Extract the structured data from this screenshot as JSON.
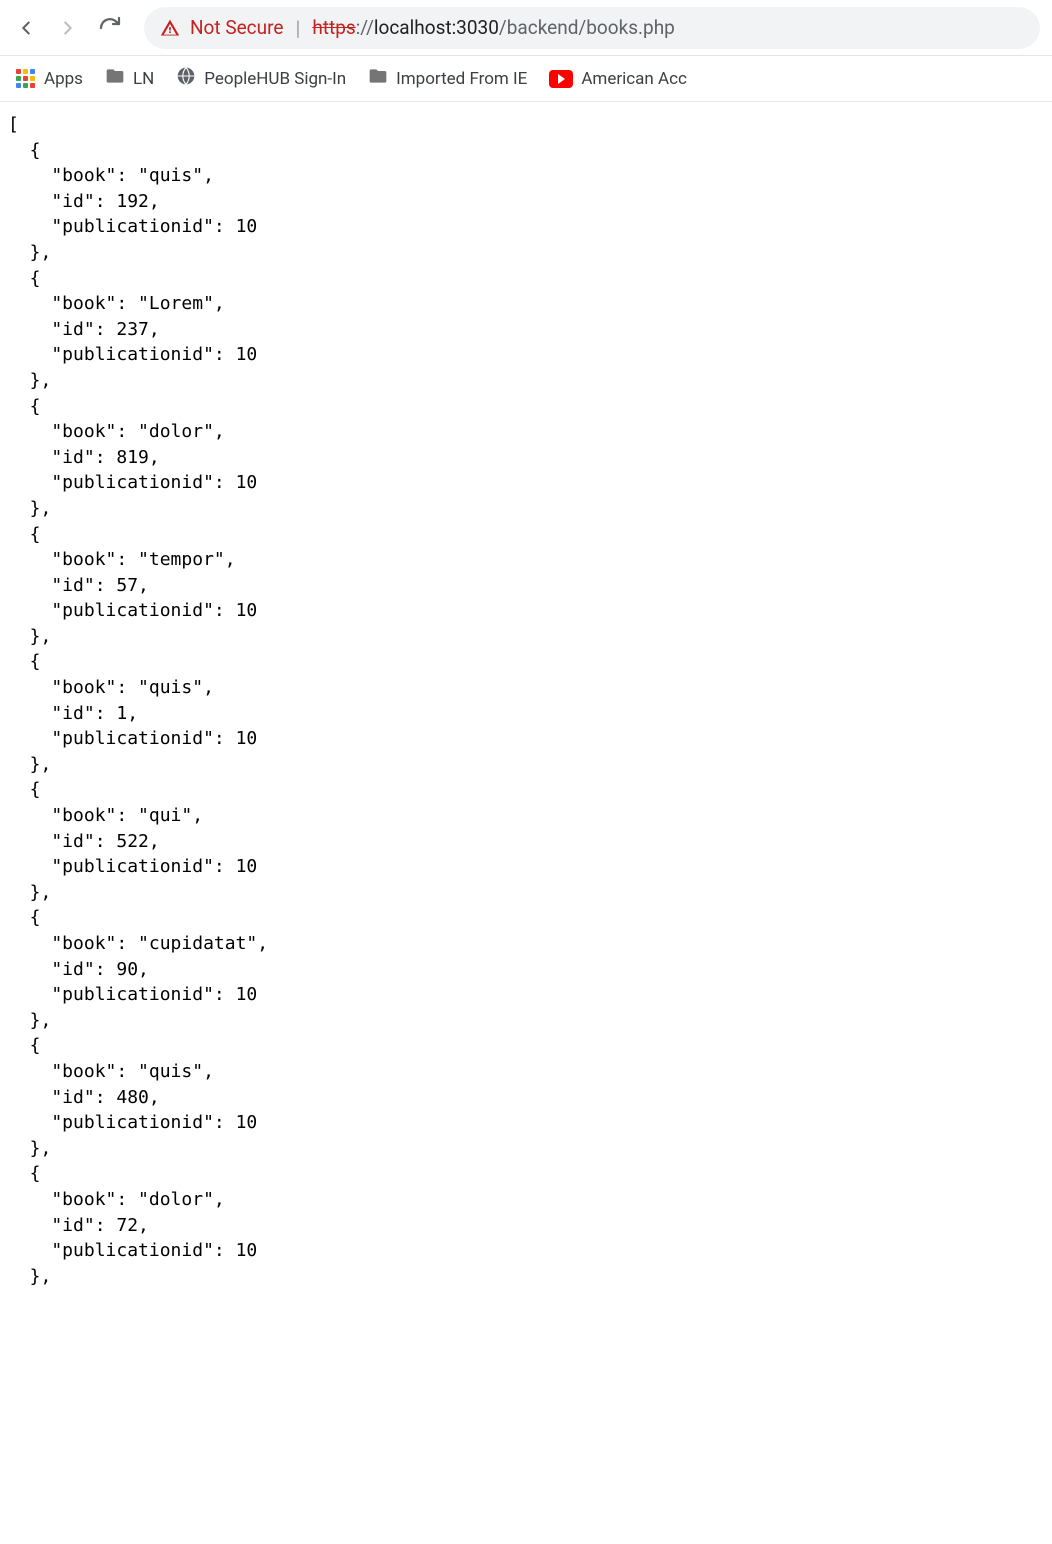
{
  "toolbar": {
    "not_secure_label": "Not Secure",
    "url_protocol": "https",
    "url_scheme_sep": "://",
    "url_host": "localhost:3030",
    "url_path": "/backend/books.php"
  },
  "bookmarks": [
    {
      "label": "Apps",
      "icon": "apps"
    },
    {
      "label": "LN",
      "icon": "folder"
    },
    {
      "label": "PeopleHUB Sign-In",
      "icon": "globe"
    },
    {
      "label": "Imported From IE",
      "icon": "folder"
    },
    {
      "label": "American Acc",
      "icon": "youtube"
    }
  ],
  "json_response": [
    {
      "book": "quis",
      "id": 192,
      "publicationid": 10
    },
    {
      "book": "Lorem",
      "id": 237,
      "publicationid": 10
    },
    {
      "book": "dolor",
      "id": 819,
      "publicationid": 10
    },
    {
      "book": "tempor",
      "id": 57,
      "publicationid": 10
    },
    {
      "book": "quis",
      "id": 1,
      "publicationid": 10
    },
    {
      "book": "qui",
      "id": 522,
      "publicationid": 10
    },
    {
      "book": "cupidatat",
      "id": 90,
      "publicationid": 10
    },
    {
      "book": "quis",
      "id": 480,
      "publicationid": 10
    },
    {
      "book": "dolor",
      "id": 72,
      "publicationid": 10
    }
  ]
}
